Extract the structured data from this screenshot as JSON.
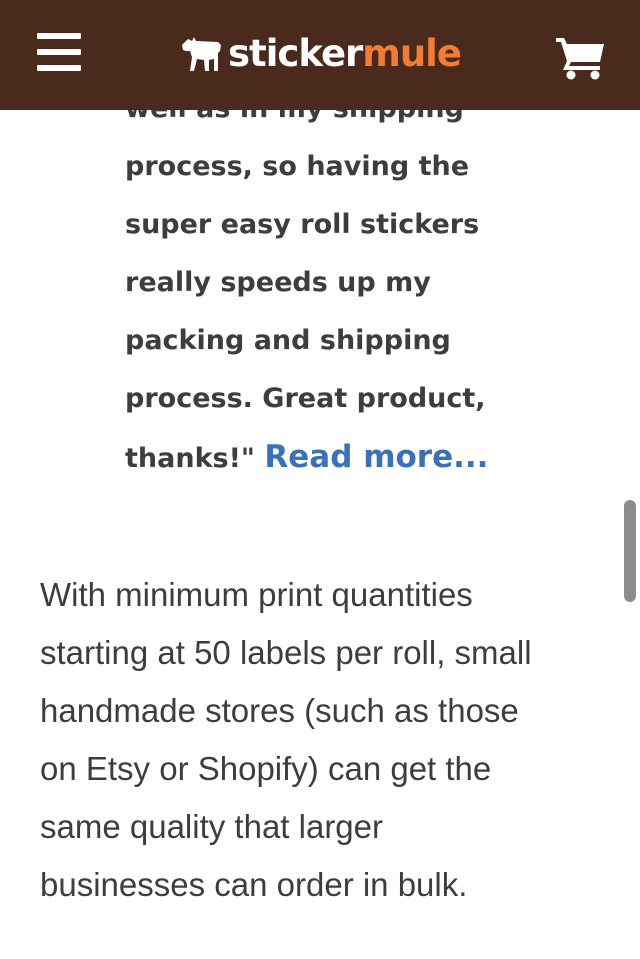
{
  "header": {
    "logo_sticker": "sticker",
    "logo_mule": "mule",
    "background_color": "#4a2a1c",
    "accent_color": "#f07d33",
    "menu_icon": "hamburger-menu-icon",
    "cart_icon": "shopping-cart-icon",
    "logo_icon": "mule-icon"
  },
  "quote": {
    "lines": [
      "well as in my shipping",
      "process, so having the",
      "super easy roll stickers",
      "really speeds up my",
      "packing and shipping",
      "process. Great product,"
    ],
    "last_line_text": "thanks!\"",
    "read_more": "Read more...",
    "link_color": "#3a72b8"
  },
  "paragraph": {
    "lines": [
      "With minimum print quantities",
      "starting at 50 labels per roll, small",
      "handmade stores (such as those",
      "on Etsy or Shopify) can get the",
      "same quality that larger",
      "businesses can order in bulk."
    ]
  }
}
